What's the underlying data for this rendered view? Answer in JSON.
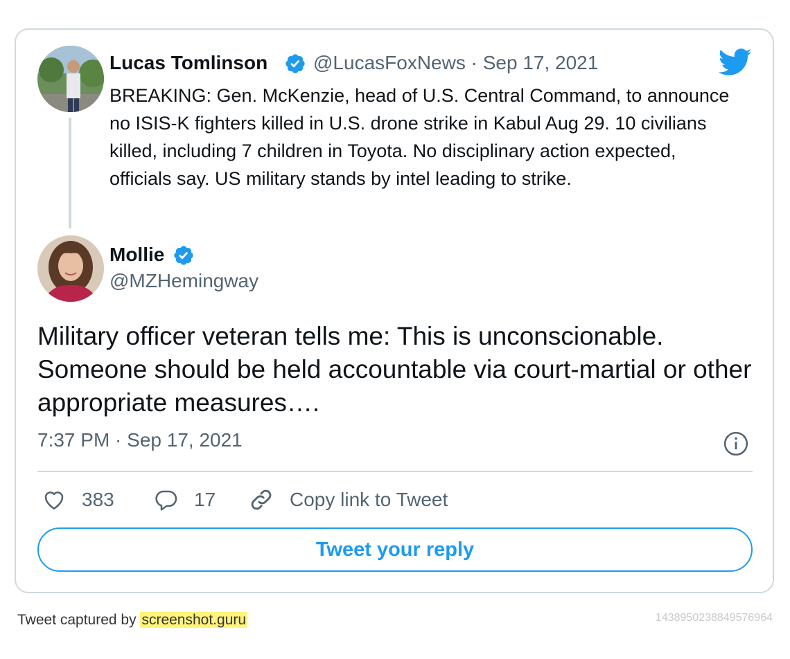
{
  "quoted_tweet": {
    "author_name": "Lucas Tomlinson",
    "handle": "@LucasFoxNews",
    "separator": "·",
    "date": "Sep 17, 2021",
    "text": "BREAKING: Gen. McKenzie, head of U.S. Central Command, to announce no ISIS-K fighters killed in U.S. drone strike in Kabul Aug 29. 10 civilians killed, including 7 children in Toyota. No disciplinary action expected, officials say. US military stands by intel leading to strike."
  },
  "tweet": {
    "author_name": "Mollie",
    "handle": "@MZHemingway",
    "text": "Military officer veteran tells me: This is unconscionable. Someone should be held accountable via court-martial or other appropriate measures….",
    "timestamp": "7:37 PM · Sep 17, 2021"
  },
  "actions": {
    "likes": "383",
    "replies": "17",
    "copy_link_label": "Copy link to Tweet"
  },
  "reply_button_label": "Tweet your reply",
  "footer": {
    "captured_by": "Tweet captured by",
    "site": "screenshot.guru",
    "tweet_id": "1438950238849576964"
  },
  "colors": {
    "accent": "#1d9bf0",
    "secondary_text": "#536471",
    "border": "#cfd9de"
  },
  "icons": [
    "verified-icon",
    "twitter-logo-icon",
    "info-icon",
    "heart-icon",
    "reply-icon",
    "link-icon"
  ]
}
